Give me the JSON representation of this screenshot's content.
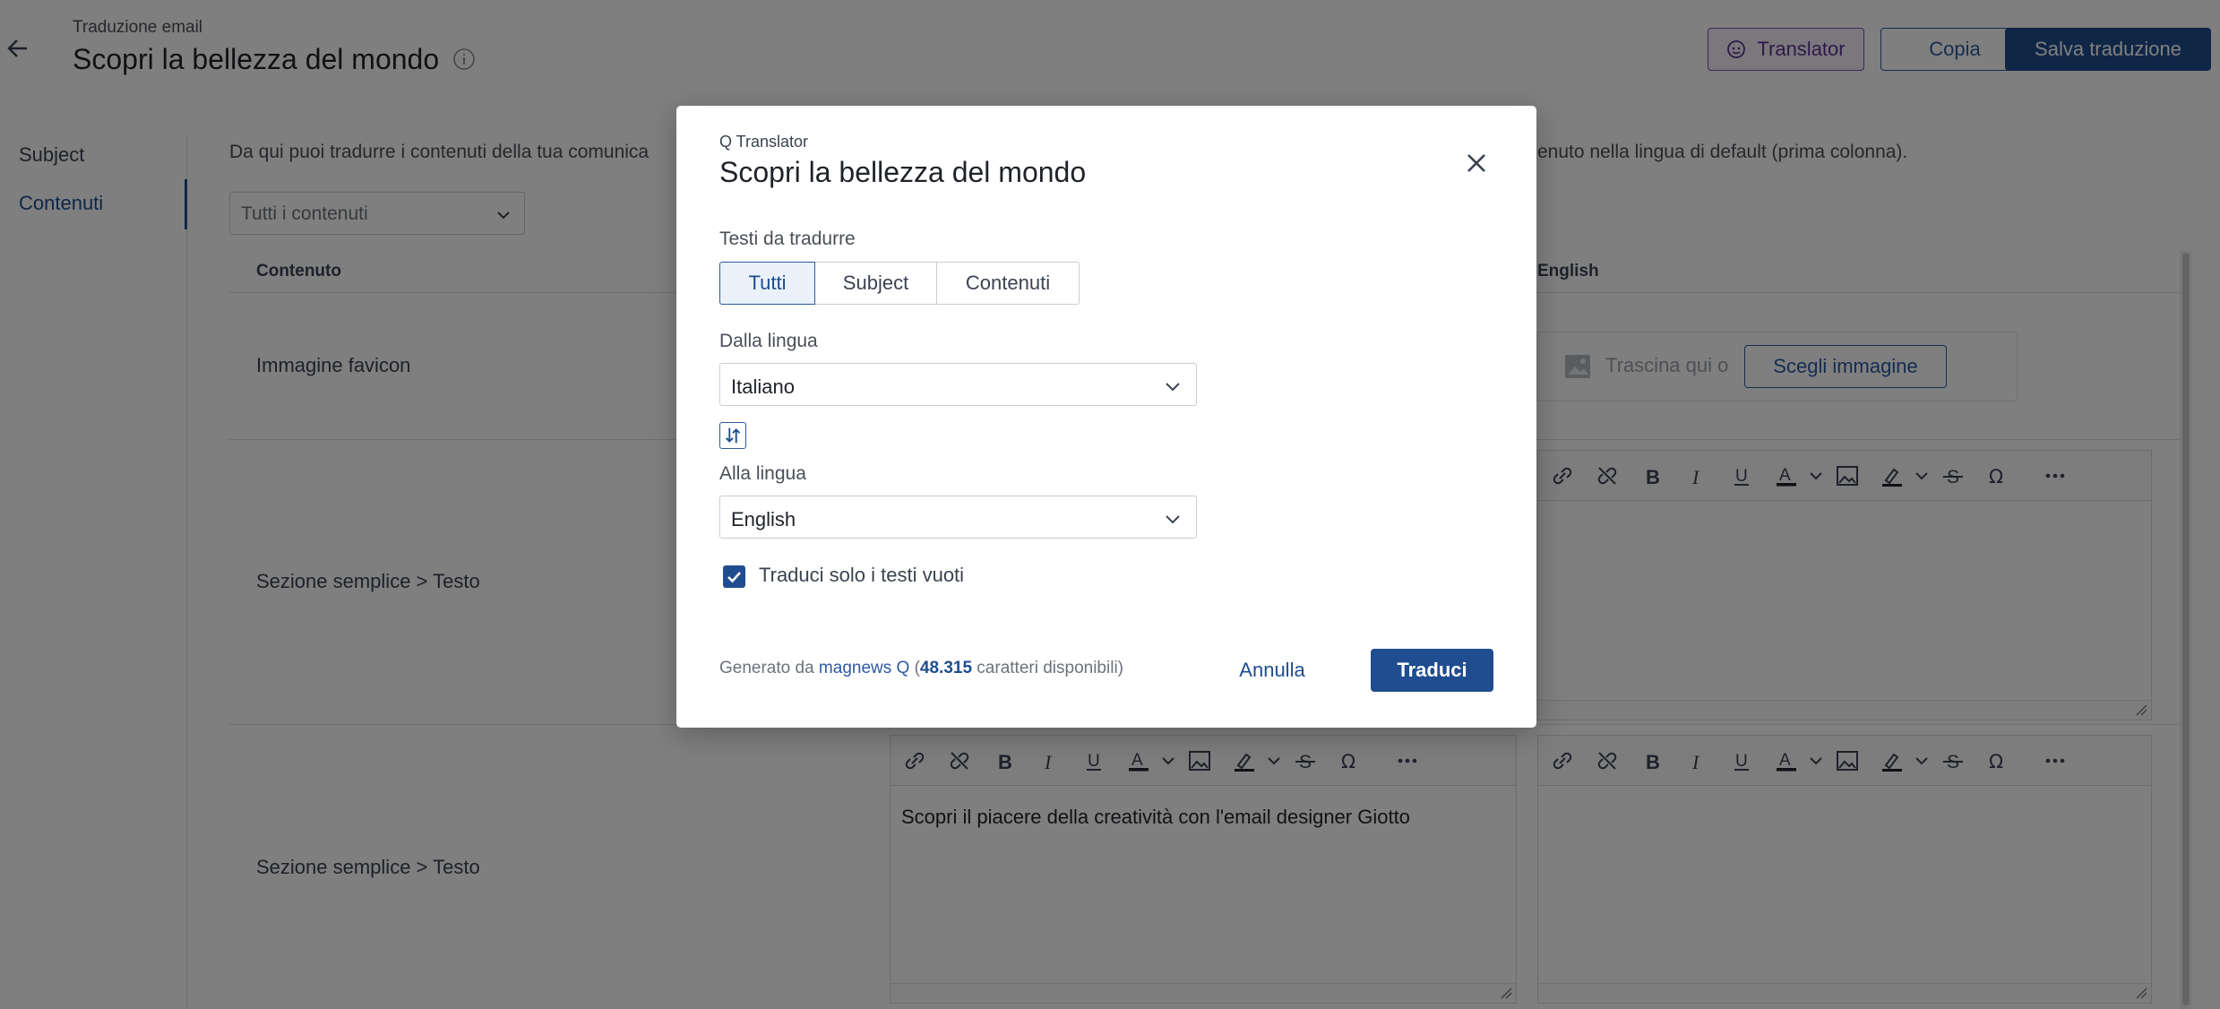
{
  "header": {
    "eyebrow": "Traduzione email",
    "title": "Scopri la bellezza del mondo",
    "translator_label": "Translator",
    "copy_label": "Copia",
    "save_label": "Salva traduzione"
  },
  "nav": {
    "items": [
      {
        "label": "Subject"
      },
      {
        "label": "Contenuti"
      }
    ]
  },
  "main": {
    "intro": "Da qui puoi tradurre i contenuti della tua comunica",
    "intro_end": "enuto nella lingua di default (prima colonna).",
    "filter_placeholder": "Tutti i contenuti",
    "col_content": "Contenuto",
    "col_english": "English",
    "rows": [
      {
        "label": "Immagine favicon"
      },
      {
        "label": "Sezione semplice > Testo"
      },
      {
        "label": "Sezione semplice > Testo"
      }
    ],
    "upload_text": "Trascina qui o",
    "choose_image": "Scegli immagine",
    "editor_text": "Scopri il piacere della creatività con l'email designer Giotto"
  },
  "modal": {
    "eyebrow": "Q Translator",
    "title": "Scopri la bellezza del mondo",
    "texts_label": "Testi da tradurre",
    "segments": [
      {
        "label": "Tutti"
      },
      {
        "label": "Subject"
      },
      {
        "label": "Contenuti"
      }
    ],
    "from_label": "Dalla lingua",
    "from_value": "Italiano",
    "to_label": "Alla lingua",
    "to_value": "English",
    "checkbox_label": "Traduci solo i testi vuoti",
    "credits_prefix": "Generato da ",
    "credits_link": "magnews Q",
    "credits_open": " (",
    "credits_count": "48.315",
    "credits_suffix": " caratteri disponibili)",
    "cancel_label": "Annulla",
    "translate_label": "Traduci"
  },
  "colors": {
    "primary": "#1f4d8f",
    "accent_purple": "#7b4db8",
    "overlay": "rgba(0,0,0,0.5)"
  }
}
